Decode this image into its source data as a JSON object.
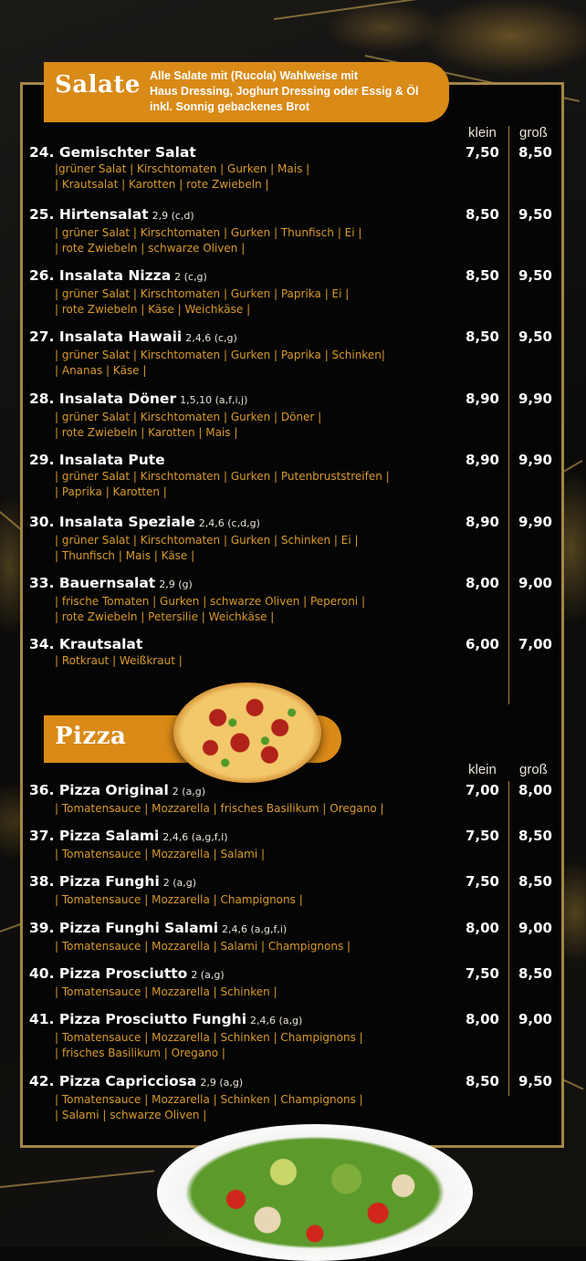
{
  "salate": {
    "title": "Salate",
    "note": [
      "Alle Salate mit (Rucola) Wahlweise mit",
      "Haus Dressing, Joghurt Dressing oder Essig & Öl",
      "inkl. Sonnig gebackenes Brot"
    ],
    "col_small": "klein",
    "col_large": "groß",
    "items": [
      {
        "title": "24. Gemischter Salat",
        "codes": "",
        "desc": [
          "|grüner Salat | Kirschtomaten | Gurken | Mais |",
          "| Krautsalat | Karotten | rote Zwiebeln |"
        ],
        "small": "7,50",
        "large": "8,50"
      },
      {
        "title": "25. Hirtensalat",
        "codes": "2,9 (c,d)",
        "desc": [
          "| grüner Salat | Kirschtomaten | Gurken | Thunfisch | Ei |",
          "| rote Zwiebeln | schwarze Oliven |"
        ],
        "small": "8,50",
        "large": "9,50"
      },
      {
        "title": "26. Insalata Nizza",
        "codes": "2 (c,g)",
        "desc": [
          "| grüner Salat | Kirschtomaten | Gurken | Paprika | Ei |",
          "| rote Zwiebeln | Käse | Weichkäse |"
        ],
        "small": "8,50",
        "large": "9,50"
      },
      {
        "title": "27. Insalata Hawaii",
        "codes": "2,4,6 (c,g)",
        "desc": [
          "| grüner Salat | Kirschtomaten | Gurken | Paprika | Schinken|",
          "| Ananas | Käse |"
        ],
        "small": "8,50",
        "large": "9,50"
      },
      {
        "title": "28. Insalata Döner",
        "codes": "1,5,10 (a,f,i,j)",
        "desc": [
          "| grüner Salat | Kirschtomaten | Gurken | Döner |",
          "| rote Zwiebeln | Karotten | Mais |"
        ],
        "small": "8,90",
        "large": "9,90"
      },
      {
        "title": "29. Insalata Pute",
        "codes": "",
        "desc": [
          "| grüner Salat | Kirschtomaten | Gurken | Putenbruststreifen |",
          "| Paprika | Karotten |"
        ],
        "small": "8,90",
        "large": "9,90"
      },
      {
        "title": "30. Insalata Speziale",
        "codes": "2,4,6 (c,d,g)",
        "desc": [
          "| grüner Salat | Kirschtomaten | Gurken | Schinken | Ei |",
          "| Thunfisch | Mais | Käse |"
        ],
        "small": "8,90",
        "large": "9,90"
      },
      {
        "title": "33. Bauernsalat",
        "codes": "2,9 (g)",
        "desc": [
          "| frische Tomaten | Gurken | schwarze Oliven | Peperoni |",
          "| rote Zwiebeln | Petersilie | Weichkäse |"
        ],
        "small": "8,00",
        "large": "9,00"
      },
      {
        "title": "34. Krautsalat",
        "codes": "",
        "desc": [
          "| Rotkraut | Weißkraut |"
        ],
        "small": "6,00",
        "large": "7,00"
      }
    ]
  },
  "pizza": {
    "title": "Pizza",
    "col_small": "klein",
    "col_large": "groß",
    "items": [
      {
        "title": "36. Pizza Original",
        "codes": "2 (a,g)",
        "desc": [
          "| Tomatensauce | Mozzarella | frisches Basilikum | Oregano |"
        ],
        "small": "7,00",
        "large": "8,00"
      },
      {
        "title": "37. Pizza Salami",
        "codes": "2,4,6 (a,g,f,i)",
        "desc": [
          "| Tomatensauce | Mozzarella | Salami |"
        ],
        "small": "7,50",
        "large": "8,50"
      },
      {
        "title": "38. Pizza Funghi",
        "codes": "2 (a,g)",
        "desc": [
          "| Tomatensauce | Mozzarella | Champignons |"
        ],
        "small": "7,50",
        "large": "8,50"
      },
      {
        "title": "39. Pizza Funghi Salami",
        "codes": "2,4,6 (a,g,f,i)",
        "desc": [
          "| Tomatensauce | Mozzarella | Salami | Champignons |"
        ],
        "small": "8,00",
        "large": "9,00"
      },
      {
        "title": "40. Pizza Prosciutto",
        "codes": "2 (a,g)",
        "desc": [
          "| Tomatensauce | Mozzarella | Schinken |"
        ],
        "small": "7,50",
        "large": "8,50"
      },
      {
        "title": "41. Pizza Prosciutto Funghi",
        "codes": "2,4,6 (a,g)",
        "desc": [
          "| Tomatensauce | Mozzarella | Schinken | Champignons |",
          "| frisches Basilikum | Oregano |"
        ],
        "small": "8,00",
        "large": "9,00"
      },
      {
        "title": "42. Pizza Capricciosa",
        "codes": "2,9 (a,g)",
        "desc": [
          "| Tomatensauce | Mozzarella | Schinken | Champignons |",
          "| Salami | schwarze Oliven |"
        ],
        "small": "8,50",
        "large": "9,50"
      }
    ]
  },
  "colors": {
    "accent": "#d98a17",
    "border_gold": "#a48544",
    "description": "#d99a2b",
    "background": "#050505"
  },
  "images": {
    "pizza": "pizza-photo",
    "salad": "salad-photo"
  }
}
